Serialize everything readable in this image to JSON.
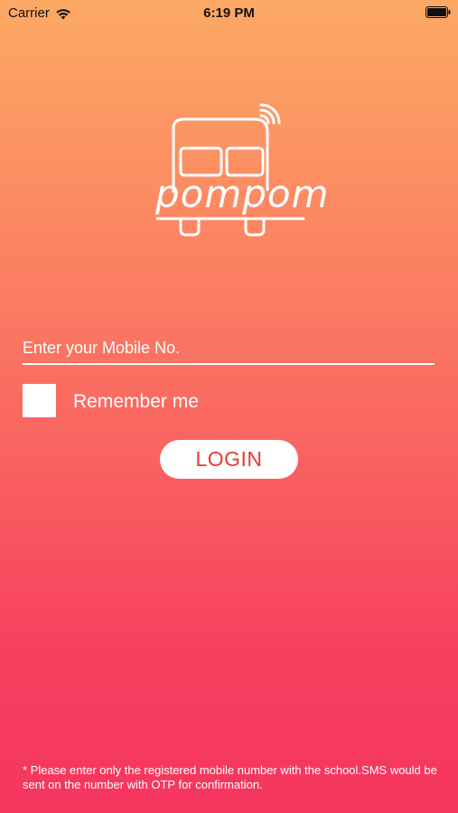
{
  "status_bar": {
    "carrier": "Carrier",
    "time": "6:19 PM",
    "icons": [
      "wifi-icon",
      "battery-icon"
    ]
  },
  "logo": {
    "text": "pompom",
    "icon": "bus-logo-icon"
  },
  "login_form": {
    "mobile_placeholder": "Enter your Mobile No.",
    "mobile_value": "",
    "remember_label": "Remember me",
    "remember_checked": false,
    "login_label": "LOGIN"
  },
  "footer": {
    "note": "* Please enter only the registered mobile number with the school.SMS would be sent on the number with OTP for confirmation."
  },
  "colors": {
    "gradient_top": "#fda964",
    "gradient_bottom": "#f5355e",
    "login_text": "#e83b2f",
    "white": "#ffffff"
  }
}
